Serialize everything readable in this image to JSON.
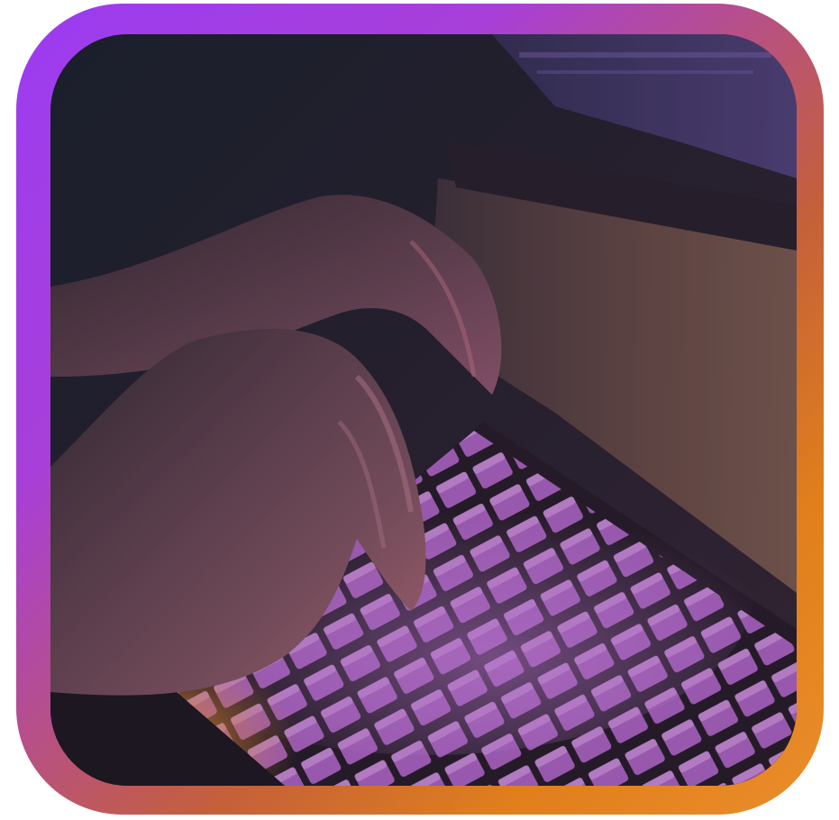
{
  "image": {
    "subject": "hands-typing-on-backlit-keyboard",
    "frame_gradient": [
      "#9b3cf2",
      "#a83fd8",
      "#c4603a",
      "#e07f1c",
      "#ea8d2a"
    ],
    "backlight_colors": {
      "keys_purple": "#c77ae0",
      "keys_orange": "#ff8a3a",
      "monitor_glow": "#6a4aa0"
    }
  }
}
